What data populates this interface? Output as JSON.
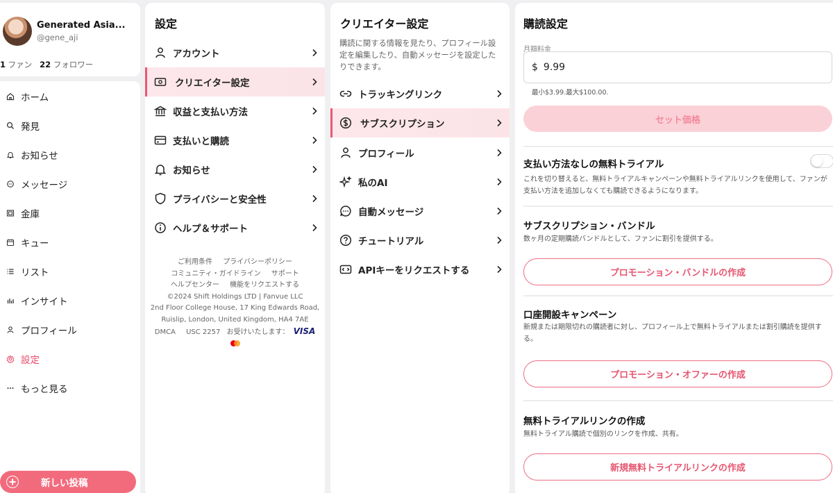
{
  "profile": {
    "name": "Generated Asia...",
    "handle": "@gene_aji",
    "fans_count": "1",
    "fans_label": "ファン",
    "followers_count": "22",
    "followers_label": "フォロワー"
  },
  "nav": {
    "items": [
      {
        "label": "ホーム",
        "icon": "home-icon"
      },
      {
        "label": "発見",
        "icon": "search-icon"
      },
      {
        "label": "お知らせ",
        "icon": "bell-icon"
      },
      {
        "label": "メッセージ",
        "icon": "chat-icon"
      },
      {
        "label": "金庫",
        "icon": "vault-icon"
      },
      {
        "label": "キュー",
        "icon": "calendar-icon"
      },
      {
        "label": "リスト",
        "icon": "list-icon"
      },
      {
        "label": "インサイト",
        "icon": "bar-chart-icon"
      },
      {
        "label": "プロフィール",
        "icon": "user-icon"
      },
      {
        "label": "設定",
        "icon": "gear-icon",
        "active": true
      },
      {
        "label": "もっと見る",
        "icon": "more-icon"
      }
    ],
    "new_post": "新しい投稿"
  },
  "settings": {
    "title": "設定",
    "items": [
      {
        "label": "アカウント",
        "icon": "user-icon"
      },
      {
        "label": "クリエイター設定",
        "icon": "money-icon",
        "active": true
      },
      {
        "label": "収益と支払い方法",
        "icon": "bank-icon"
      },
      {
        "label": "支払いと購読",
        "icon": "card-icon"
      },
      {
        "label": "お知らせ",
        "icon": "bell-icon"
      },
      {
        "label": "プライバシーと安全性",
        "icon": "shield-icon"
      },
      {
        "label": "ヘルプ＆サポート",
        "icon": "info-icon"
      }
    ],
    "footer": {
      "terms": "ご利用条件",
      "privacy": "プライバシーポリシー",
      "guidelines": "コミュニティ・ガイドライン",
      "support": "サポート",
      "help_center": "ヘルプセンター",
      "request_feature": "機能をリクエストする",
      "copyright": "©2024 Shift Holdings LTD | Fanvue LLC",
      "address1": "2nd Floor College House, 17 King Edwards Road,",
      "address2": "Ruislip, London, United Kingdom, HA4 7AE",
      "dmca": "DMCA",
      "usc": "USC 2257",
      "accepted": "お受けいたします：",
      "visa": "VISA"
    }
  },
  "creator": {
    "title": "クリエイター設定",
    "description": "購読に関する情報を見たり、プロフィール設定を編集したり、自動メッセージを設定したりできます。",
    "items": [
      {
        "label": "トラッキングリンク",
        "icon": "link-icon"
      },
      {
        "label": "サブスクリプション",
        "icon": "dollar-circle-icon",
        "active": true
      },
      {
        "label": "プロフィール",
        "icon": "user-icon"
      },
      {
        "label": "私のAI",
        "icon": "sparkle-icon"
      },
      {
        "label": "自動メッセージ",
        "icon": "chat-icon"
      },
      {
        "label": "チュートリアル",
        "icon": "question-icon"
      },
      {
        "label": "APIキーをリクエストする",
        "icon": "api-icon"
      }
    ]
  },
  "subscription": {
    "title": "購読設定",
    "price_label": "月額料金",
    "currency": "$",
    "price_value": "9.99",
    "price_hint": "最小$3.99.最大$100.00.",
    "set_price": "セット価格",
    "free_trial": {
      "title": "支払い方法なしの無料トライアル",
      "desc": "これを切り替えると、無料トライアルキャンペーンや無料トライアルリンクを使用して、ファンが支払い方法を追加しなくても購読できるようになります。",
      "enabled": false
    },
    "bundle": {
      "title": "サブスクリプション・バンドル",
      "desc": "数ヶ月の定期購読バンドルとして、ファンに割引を提供する。",
      "button": "プロモーション・バンドルの作成"
    },
    "campaign": {
      "title": "口座開設キャンペーン",
      "desc": "新規または期限切れの購読者に対し、プロフィール上で無料トライアルまたは割引購読を提供する。",
      "button": "プロモーション・オファーの作成"
    },
    "trial_link": {
      "title": "無料トライアルリンクの作成",
      "desc": "無料トライアル購読で個別のリンクを作成、共有。",
      "button": "新規無料トライアルリンクの作成"
    }
  },
  "colors": {
    "accent": "#e85a74",
    "accent_light": "#fbd1d8",
    "primary_button": "#f26b7d"
  }
}
